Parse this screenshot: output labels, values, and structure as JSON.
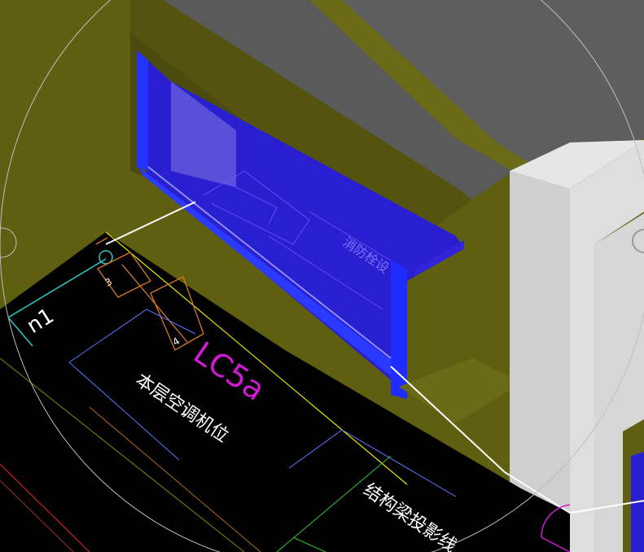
{
  "scene": {
    "colors": {
      "wall_face": "#5f5f12",
      "wall_top": "#6b6b16",
      "wall_dark": "#4a4a0e",
      "slab": "#5e5e5e",
      "glass": "#2a1fd0",
      "glass_light": "#4b44d8",
      "frame": "#1f2bff",
      "column_light": "#dcdcdc",
      "column_mid": "#cfcfcf",
      "cad_bg": "#000000",
      "yellow_line": "#e6e600",
      "white_line": "#ffffff",
      "cyan": "#30c8c8",
      "orange": "#d77a22",
      "magenta": "#d21ad2",
      "red": "#d02020",
      "blue_line": "#5a78ff"
    },
    "labels": {
      "window_tag": "LC5a",
      "grid_marker": "n1",
      "room_label": "本层空调机位",
      "beam_label": "结构梁投影线",
      "ghost_label": "消防栓设",
      "box_num_1": "3",
      "box_num_2": "4"
    }
  }
}
